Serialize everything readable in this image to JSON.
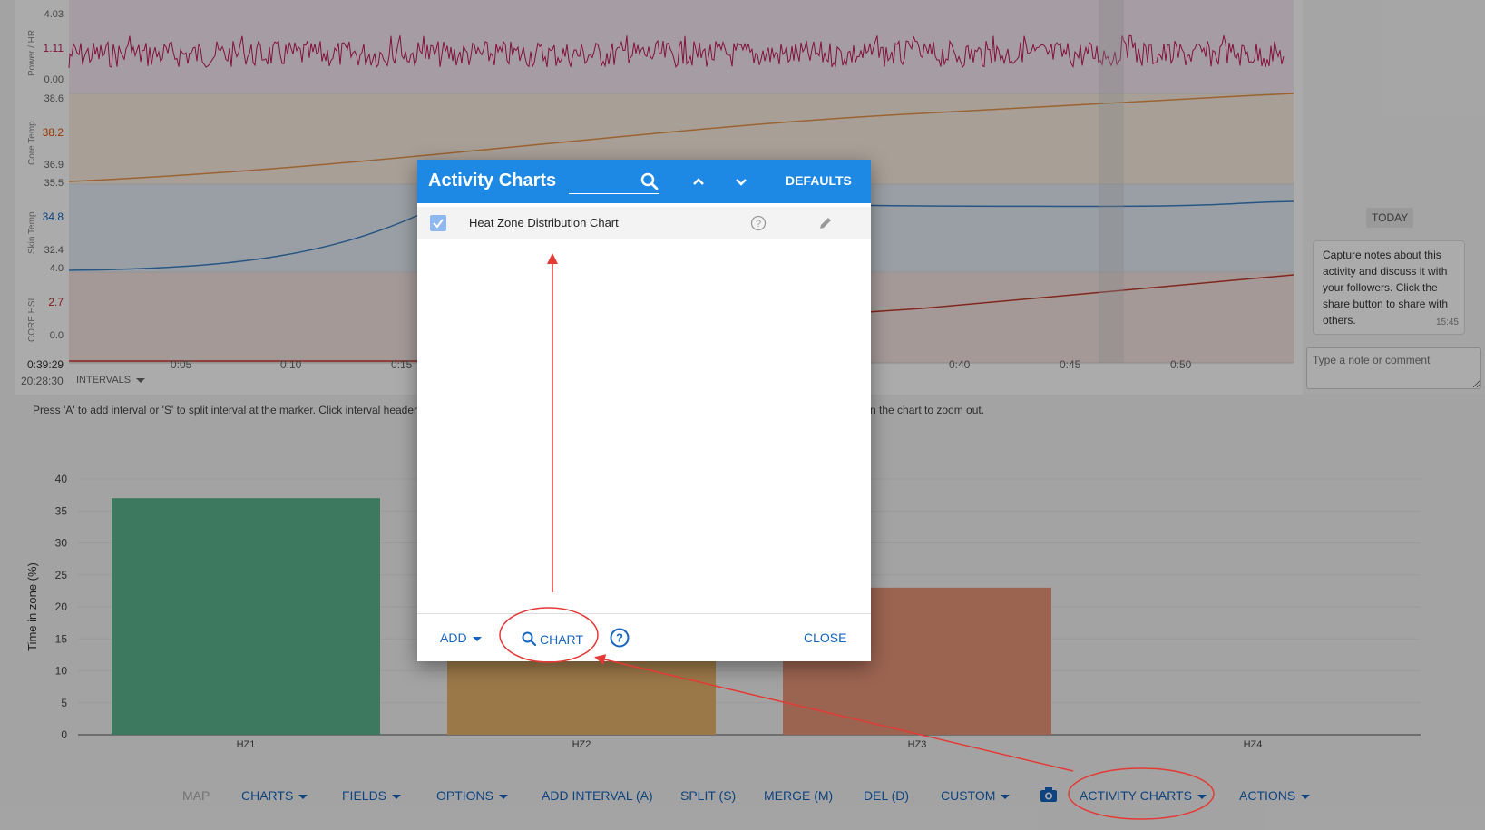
{
  "traces": {
    "rows": [
      {
        "label": "Power / HR",
        "ticks": [
          "4.03",
          "1.11",
          "0.00"
        ],
        "mid_color": "#c2185b"
      },
      {
        "label": "Core Temp",
        "ticks": [
          "38.6",
          "38.2",
          "36.9"
        ],
        "mid_color": "#e65100"
      },
      {
        "label": "Skin Temp",
        "ticks": [
          "35.5",
          "34.8",
          "32.4"
        ],
        "mid_color": "#1565c0"
      },
      {
        "label": "CORE HSI",
        "ticks": [
          "4.0",
          "2.7",
          "0.0"
        ],
        "mid_color": "#c62828"
      }
    ],
    "x_ticks": [
      "0:05",
      "0:10",
      "0:15",
      "0:40",
      "0:45",
      "0:50"
    ],
    "time_start": "0:39:29",
    "clock": "20:28:30",
    "intervals_label": "INTERVALS"
  },
  "notes": {
    "today_label": "TODAY",
    "note_text": "Capture notes about this activity and discuss it with your followers. Click the share button to share with others.",
    "note_time": "15:45",
    "input_placeholder": "Type a note or comment"
  },
  "help_text": "Press 'A' to add interval or 'S' to split interval at the marker. Click interval header",
  "help_text_tail": "n the chart to zoom out.",
  "chart_data": {
    "type": "bar",
    "categories": [
      "HZ1",
      "HZ2",
      "HZ3",
      "HZ4"
    ],
    "values": [
      37,
      23,
      23,
      0
    ],
    "colors": [
      "#5bb58e",
      "#e8b36c",
      "#e8957a",
      "#cccccc"
    ],
    "ylabel": "Time in zone (%)",
    "ylim": [
      0,
      40
    ],
    "yticks": [
      0,
      5,
      10,
      15,
      20,
      25,
      30,
      35,
      40
    ],
    "grid": true
  },
  "toolbar": {
    "map": "MAP",
    "charts": "CHARTS",
    "fields": "FIELDS",
    "options": "OPTIONS",
    "add_interval": "ADD INTERVAL (A)",
    "split": "SPLIT (S)",
    "merge": "MERGE (M)",
    "del": "DEL (D)",
    "custom": "CUSTOM",
    "activity_charts": "ACTIVITY CHARTS",
    "actions": "ACTIONS"
  },
  "dialog": {
    "title": "Activity Charts",
    "defaults_label": "DEFAULTS",
    "charts": [
      {
        "label": "Heat Zone Distribution Chart",
        "checked": true
      }
    ],
    "add_label": "ADD",
    "chart_label": "CHART",
    "close_label": "CLOSE"
  },
  "colors": {
    "accent": "#1e88e5",
    "link": "#1565c0",
    "annotation": "#e53935"
  }
}
